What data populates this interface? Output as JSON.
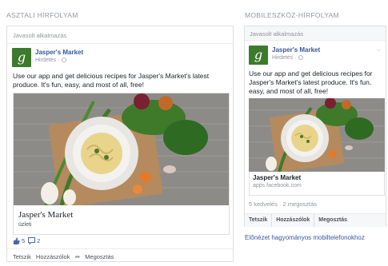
{
  "desktop": {
    "section_title": "ASZTALI HÍRFOLYAM",
    "header": "Javasolt alkalmazás",
    "page_name": "Jasper's Market",
    "sponsored": "Hirdetés ·",
    "body_text": "Use our app and get delicious recipes for Jasper's Market's latest produce. It's fun, easy, and most of all, free!",
    "caption_title": "Jasper's Market",
    "caption_sub": "üzleti",
    "likes": "5",
    "comments": "2",
    "actions": [
      "Tetszik",
      "Hozzászólok",
      "Megosztás"
    ]
  },
  "mobile": {
    "section_title": "MOBILESZKÖZ-HÍRFOLYAM",
    "header": "Javasolt alkalmazás",
    "page_name": "Jasper's Market",
    "sponsored": "Hirdetés ·",
    "body_text": "Use our app and get delicious recipes for Jasper's Market's latest produce. It's fun, easy, and most of all, free!",
    "caption_title": "Jasper's Market",
    "caption_url": "apps.facebook.com",
    "stats": "5 kedvelés · 2 megosztás",
    "actions": [
      "Tetszik",
      "Hozzászólok",
      "Megosztás"
    ]
  },
  "preview_link": "Előnézet hagyományos mobiltelefonokhoz",
  "logo_letter": "g",
  "colors": {
    "link": "#365899",
    "logo": "#3c7a2c",
    "muted": "#90949c"
  },
  "icons": {
    "like": "thumbs-up-icon",
    "comment": "comment-icon",
    "share": "share-arrow-icon",
    "globe": "globe-icon",
    "chevron": "chevron-down-icon"
  }
}
